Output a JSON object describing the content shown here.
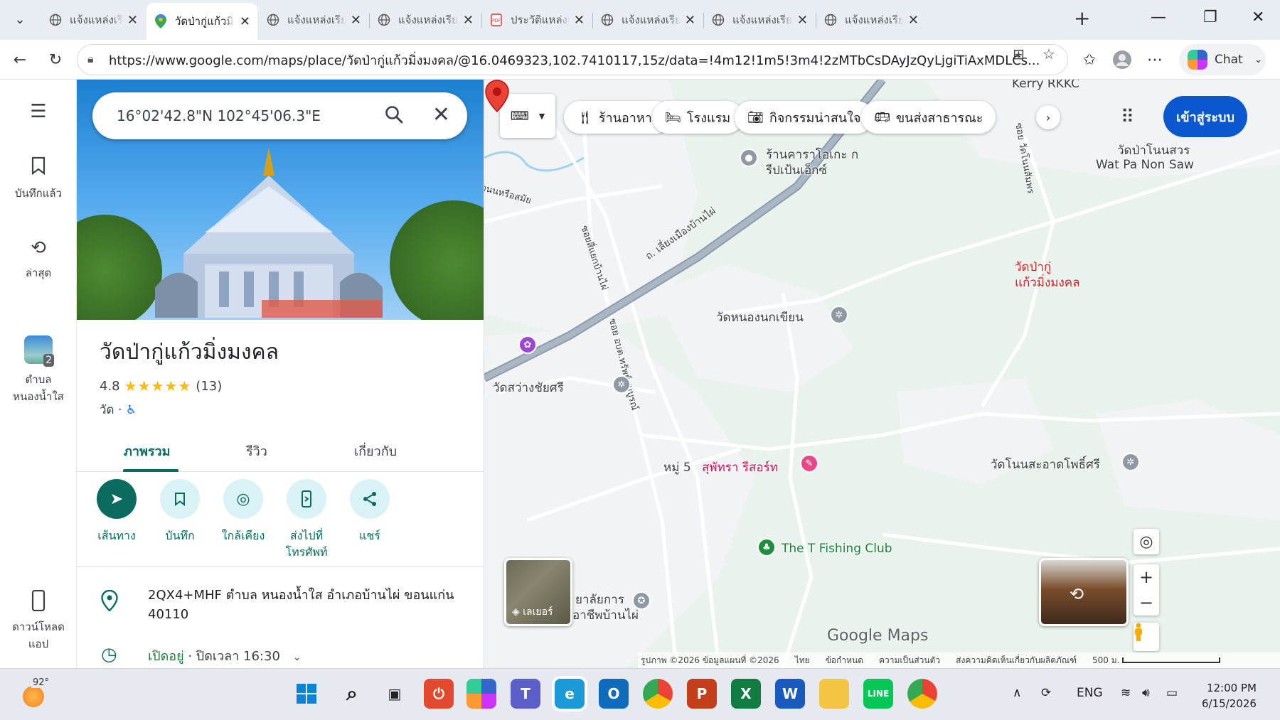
{
  "browser": {
    "tabs": [
      {
        "title": "แจ้งแหล่งเรียนรู้",
        "icon": "globe-icon"
      },
      {
        "title": "วัดป่ากู่แก้วมิ่งมงคล",
        "icon": "google-maps-icon"
      },
      {
        "title": "แจ้งแหล่งเรียนรู้",
        "icon": "globe-icon"
      },
      {
        "title": "แจ้งแหล่งเรียนรู้",
        "icon": "globe-icon"
      },
      {
        "title": "ประวัติแหล่งเรียน",
        "icon": "pdf-icon"
      },
      {
        "title": "แจ้งแหล่งเรียนรู้",
        "icon": "globe-icon"
      },
      {
        "title": "แจ้งแหล่งเรียนรู้",
        "icon": "globe-icon"
      },
      {
        "title": "แจ้งแหล่งเรียนรู้",
        "icon": "globe-icon"
      }
    ],
    "url": "https://www.google.com/maps/place/วัดป่ากู่แก้วมิ่งมงคล/@16.0469323,102.7410117,15z/data=!4m12!1m5!3m4!2zMTbCsDAyJzQyLjgiTiAxMDLCs...",
    "copilot_label": "Chat"
  },
  "rail": {
    "saved": "บันทึกแล้ว",
    "recent": "ล่าสุด",
    "area_line1": "ตำบล",
    "area_line2": "หนองน้ำใส",
    "area_badge": "2",
    "download_line1": "ดาวน์โหลด",
    "download_line2": "แอป"
  },
  "search": {
    "query": "16°02'42.8\"N 102°45'06.3\"E"
  },
  "place": {
    "title": "วัดป่ากู่แก้วมิ่งมงคล",
    "rating": "4.8",
    "stars": "★★★★★",
    "review_count": "(13)",
    "category": "วัด",
    "tabs": [
      "ภาพรวม",
      "รีวิว",
      "เกี่ยวกับ"
    ],
    "actions": [
      {
        "label": "เส้นทาง",
        "icon": "directions-icon"
      },
      {
        "label": "บันทึก",
        "icon": "bookmark-icon"
      },
      {
        "label": "ใกล้เคียง",
        "icon": "nearby-icon"
      },
      {
        "label_line1": "ส่งไปที่",
        "label_line2": "โทรศัพท์",
        "icon": "send-to-phone-icon"
      },
      {
        "label": "แชร์",
        "icon": "share-icon"
      }
    ],
    "address": "2QX4+MHF ตำบล หนองน้ำใส อำเภอบ้านไผ่ ขอนแก่น 40110",
    "hours_open": "เปิดอยู่",
    "hours_close": " · ปิดเวลา 16:30"
  },
  "map": {
    "chips": [
      "ร้านอาหาร",
      "โรงแรม",
      "กิจกรรมน่าสนใจ",
      "ขนส่งสาธารณะ"
    ],
    "signin": "เข้าสู่ระบบ",
    "labels": {
      "kerry": "Kerry RKKC",
      "wat_pa_non_th": "วัดป่าโนนสวร",
      "wat_pa_non_en": "Wat Pa Non Saw",
      "karaoke_1": "ร้านคาราโอเกะ ก",
      "karaoke_2": "รีปเป้นเอ็กซ์",
      "road_main": "ถ. เลี่ยงเมืองบ้านไผ่",
      "road_side": "ซอย วัดโนนสัมพร",
      "road_left": "ซอยสี่แยกบ้านไผ่",
      "road_mid": "ซอย อบต.ทรัพย์สมบูรณ์",
      "road_mid2": "ถนนหรือสมัย",
      "pin_line1": "วัดป่ากู่",
      "pin_line2": "แก้วมิ่งมงคล",
      "wat_nong": "วัดหนองนกเขียน",
      "wat_sawang": "วัดสว่างชัยศรี",
      "moo5": "หมู่ 5",
      "resort": "สุพัทรา รีสอร์ท",
      "wat_non": "วัดโนนสะอาดโพธิ์ศรี",
      "fishing": "The T Fishing Club",
      "school_1": "ยาลัยการ",
      "school_2": "อาชีพบ้านไผ่",
      "layers": "เลเยอร์"
    },
    "logo": "Google Maps",
    "attribution": [
      "รูปภาพ ©2026 ข้อมูลแผนที่ ©2026",
      "ไทย",
      "ข้อกำหนด",
      "ความเป็นส่วนตัว",
      "ส่งความคิดเห็นเกี่ยวกับผลิตภัณฑ์"
    ],
    "scale_label": "500 ม."
  },
  "taskbar": {
    "weather_temp": "92°",
    "lang": "ENG",
    "time": "12:00 PM",
    "date": "6/15/2026"
  }
}
